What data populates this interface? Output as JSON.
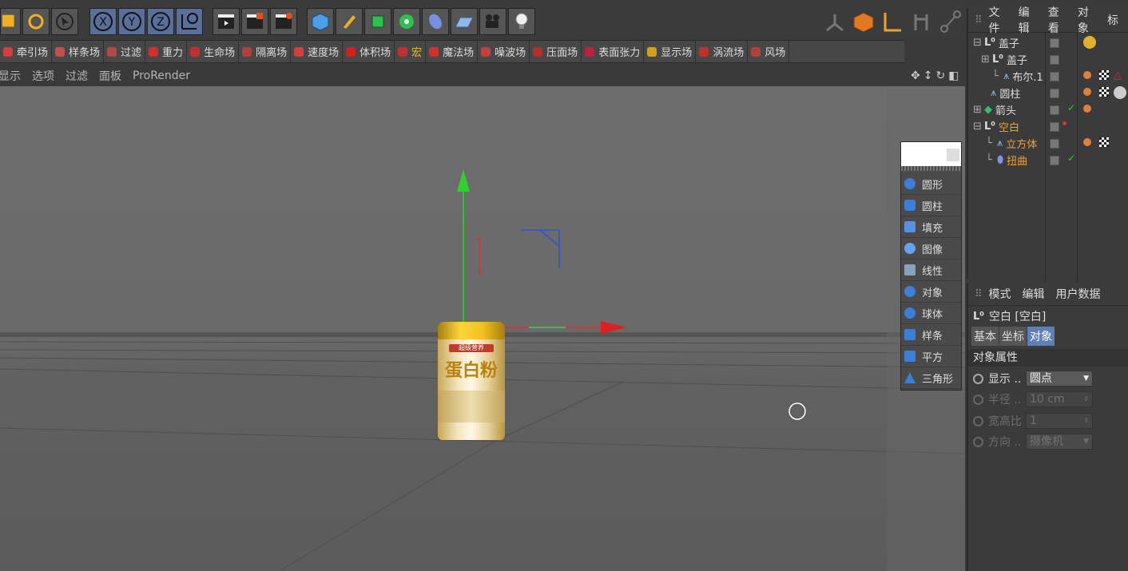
{
  "field_bar": {
    "items": [
      "牵引场",
      "样条场",
      "过滤",
      "重力",
      "生命场",
      "隔离场",
      "速度场",
      "体积场",
      "宏",
      "魔法场",
      "噪波场",
      "压面场",
      "表面张力",
      "显示场",
      "涡流场",
      "风场"
    ]
  },
  "viewport_menu": {
    "items": [
      "显示",
      "选项",
      "过滤",
      "面板",
      "ProRender"
    ]
  },
  "can_label": {
    "line1": "超级营养",
    "line2": "蛋白粉"
  },
  "popup": {
    "items": [
      "圆形",
      "圆柱",
      "填充",
      "图像",
      "线性",
      "对象",
      "球体",
      "样条",
      "平方",
      "三角形"
    ]
  },
  "object_manager": {
    "menu": [
      "文件",
      "编辑",
      "查看",
      "对象",
      "标"
    ],
    "rows": [
      {
        "name": "盖子",
        "highlight": false
      },
      {
        "name": "盖子",
        "highlight": false
      },
      {
        "name": "布尔.1",
        "highlight": false
      },
      {
        "name": "圆柱",
        "highlight": false
      },
      {
        "name": "箭头",
        "highlight": false
      },
      {
        "name": "空白",
        "highlight": true
      },
      {
        "name": "立方体",
        "highlight": true
      },
      {
        "name": "扭曲",
        "highlight": true
      }
    ]
  },
  "attribute_manager": {
    "menu": [
      "模式",
      "编辑",
      "用户数据"
    ],
    "object_title": "空白 [空白]",
    "tabs": [
      "基本",
      "坐标",
      "对象"
    ],
    "section_title": "对象属性",
    "props": [
      {
        "label": "显示 ..",
        "value": "圆点",
        "enabled": true
      },
      {
        "label": "半径 ..",
        "value": "10 cm",
        "enabled": false
      },
      {
        "label": "宽高比",
        "value": "1",
        "enabled": false
      },
      {
        "label": "方向 ..",
        "value": "摄像机",
        "enabled": false
      }
    ]
  },
  "colors": {
    "accent_blue": "#5f80b6",
    "highlight_orange": "#f0a030",
    "axis_x": "#e03030",
    "axis_y": "#30c030",
    "axis_z": "#3050e0"
  }
}
